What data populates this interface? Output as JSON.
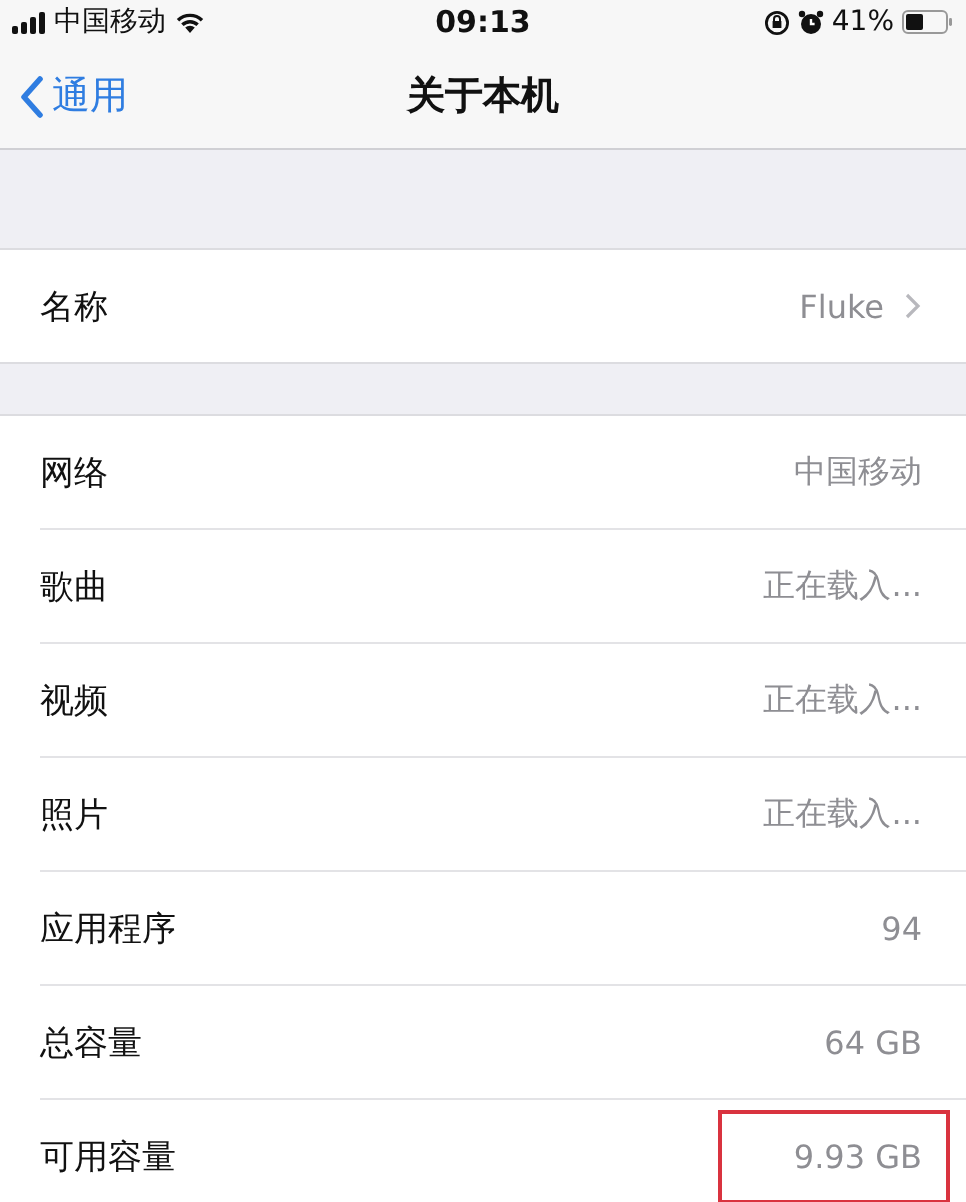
{
  "status_bar": {
    "carrier": "中国移动",
    "time": "09:13",
    "battery": "41%"
  },
  "nav": {
    "back": "通用",
    "title": "关于本机"
  },
  "sections": [
    {
      "rows": [
        {
          "label": "名称",
          "value": "Fluke",
          "chevron": true,
          "highlighted": false
        }
      ]
    },
    {
      "rows": [
        {
          "label": "网络",
          "value": "中国移动",
          "chevron": false,
          "highlighted": false
        },
        {
          "label": "歌曲",
          "value": "正在载入...",
          "chevron": false,
          "highlighted": false
        },
        {
          "label": "视频",
          "value": "正在载入...",
          "chevron": false,
          "highlighted": false
        },
        {
          "label": "照片",
          "value": "正在载入...",
          "chevron": false,
          "highlighted": false
        },
        {
          "label": "应用程序",
          "value": "94",
          "chevron": false,
          "highlighted": false
        },
        {
          "label": "总容量",
          "value": "64 GB",
          "chevron": false,
          "highlighted": false
        },
        {
          "label": "可用容量",
          "value": "9.93 GB",
          "chevron": false,
          "highlighted": true
        }
      ]
    }
  ]
}
